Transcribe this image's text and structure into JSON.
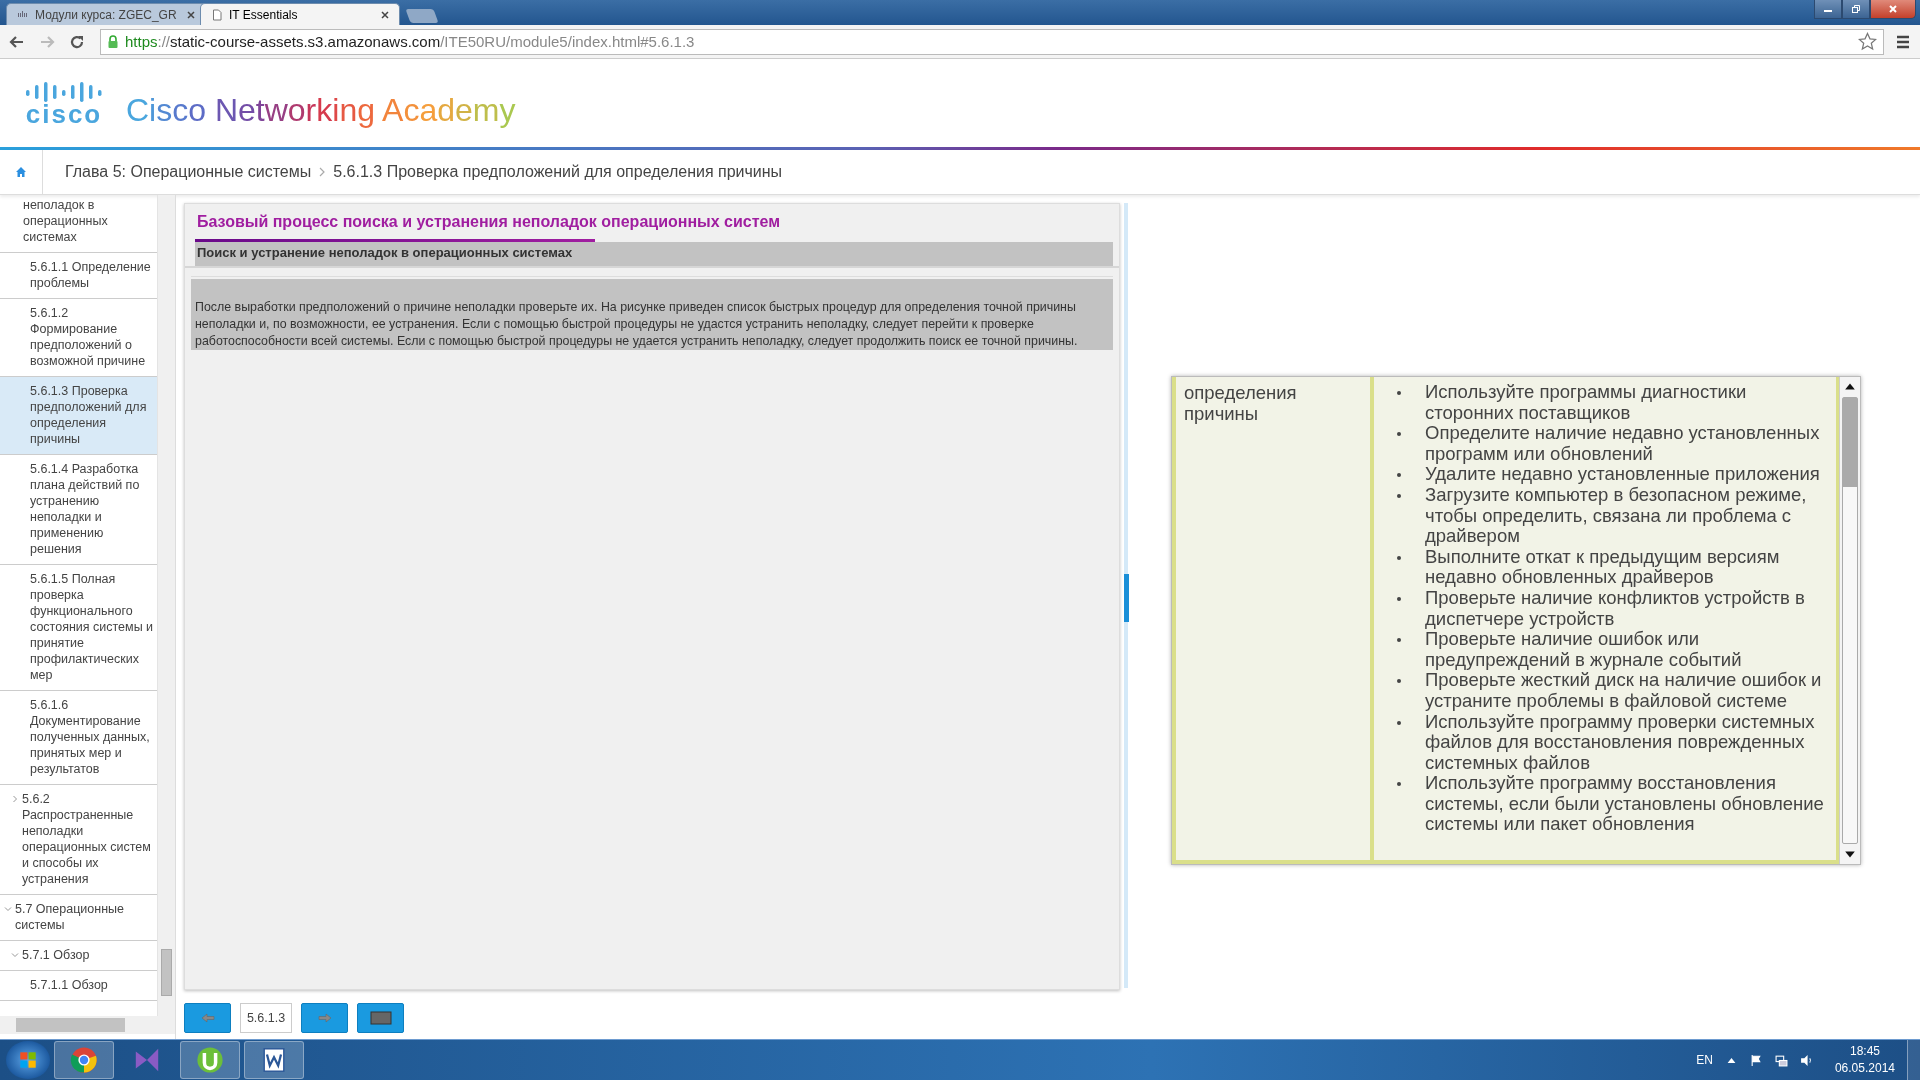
{
  "browser": {
    "tabs": [
      {
        "title": "Модули курса: ZGEC_GR",
        "selected": false
      },
      {
        "title": "IT Essentials",
        "selected": true
      }
    ],
    "url": {
      "scheme": "https",
      "separator": "://",
      "host": "static-course-assets.s3.amazonaws.com",
      "path": "/ITE50RU/module5/index.html#5.6.1.3"
    },
    "forward_disabled": true
  },
  "header": {
    "logo": "cisco",
    "title": "Cisco Networking Academy"
  },
  "breadcrumb": [
    "Глава 5: Операционные системы",
    "5.6.1.3 Проверка предположений для определения причины"
  ],
  "sidebar": {
    "tree": [
      {
        "children": [
          {
            "label": "неполадок в операционных системах",
            "selected": false,
            "children": [
              {
                "label": "5.6.1.1 Определение проблемы",
                "selected": false
              },
              {
                "label": "5.6.1.2 Формирование предположений о возможной причине",
                "selected": false
              },
              {
                "label": "5.6.1.3 Проверка предположений для определения причины",
                "selected": true
              },
              {
                "label": "5.6.1.4 Разработка плана действий по устранению неполадки и применению решения",
                "selected": false
              },
              {
                "label": "5.6.1.5 Полная проверка функционального состояния системы и принятие профилактических мер",
                "selected": false
              },
              {
                "label": "5.6.1.6 Документирование полученных данных, принятых мер и результатов",
                "selected": false
              }
            ]
          },
          {
            "label": "5.6.2 Распространенные неполадки операционных систем и способы их устранения",
            "selected": false,
            "expanded": false
          }
        ]
      },
      {
        "label": "5.7 Операционные системы",
        "selected": false,
        "expanded": true,
        "children": [
          {
            "label": "5.7.1 Обзор",
            "selected": false,
            "expanded": true,
            "children": [
              {
                "label": "5.7.1.1 Обзор",
                "selected": false
              }
            ]
          }
        ]
      }
    ]
  },
  "main": {
    "title": "Базовый процесс поиска и устранения неполадок операционных систем",
    "subtitle": "Поиск и устранение неполадок в операционных системах",
    "paragraph": "После выработки предположений о причине неполадки проверьте их. На рисунке приведен список быстрых процедур для определения точной причины неполадки и, по возможности, ее устранения. Если с помощью быстрой процедуры не удастся устранить неполадку, следует перейти к проверке работоспособности всей системы. Если с помощью быстрой процедуры не удается устранить неполадку, следует продолжить поиск ее точной причины."
  },
  "nav": {
    "page": "5.6.1.3"
  },
  "figure": {
    "column_1": "определения причины",
    "column_2": [
      "Используйте программы диагностики сторонних поставщиков",
      "Определите наличие недавно установленных программ или обновлений",
      "Удалите недавно установленные приложения",
      "Загрузите компьютер в безопасном режиме, чтобы определить, связана ли проблема с драйвером",
      "Выполните откат к предыдущим версиям недавно обновленных драйверов",
      "Проверьте наличие конфликтов устройств в диспетчере устройств",
      "Проверьте наличие ошибок или предупреждений в журнале событий",
      "Проверьте жесткий диск на наличие ошибок и устраните проблемы в файловой системе",
      "Используйте программу проверки системных файлов для восстановления поврежденных системных файлов",
      "Используйте программу восстановления системы, если были установлены обновление системы или пакет обновления"
    ]
  },
  "taskbar": {
    "language": "EN",
    "time": "18:45",
    "date": "06.05.2014"
  }
}
